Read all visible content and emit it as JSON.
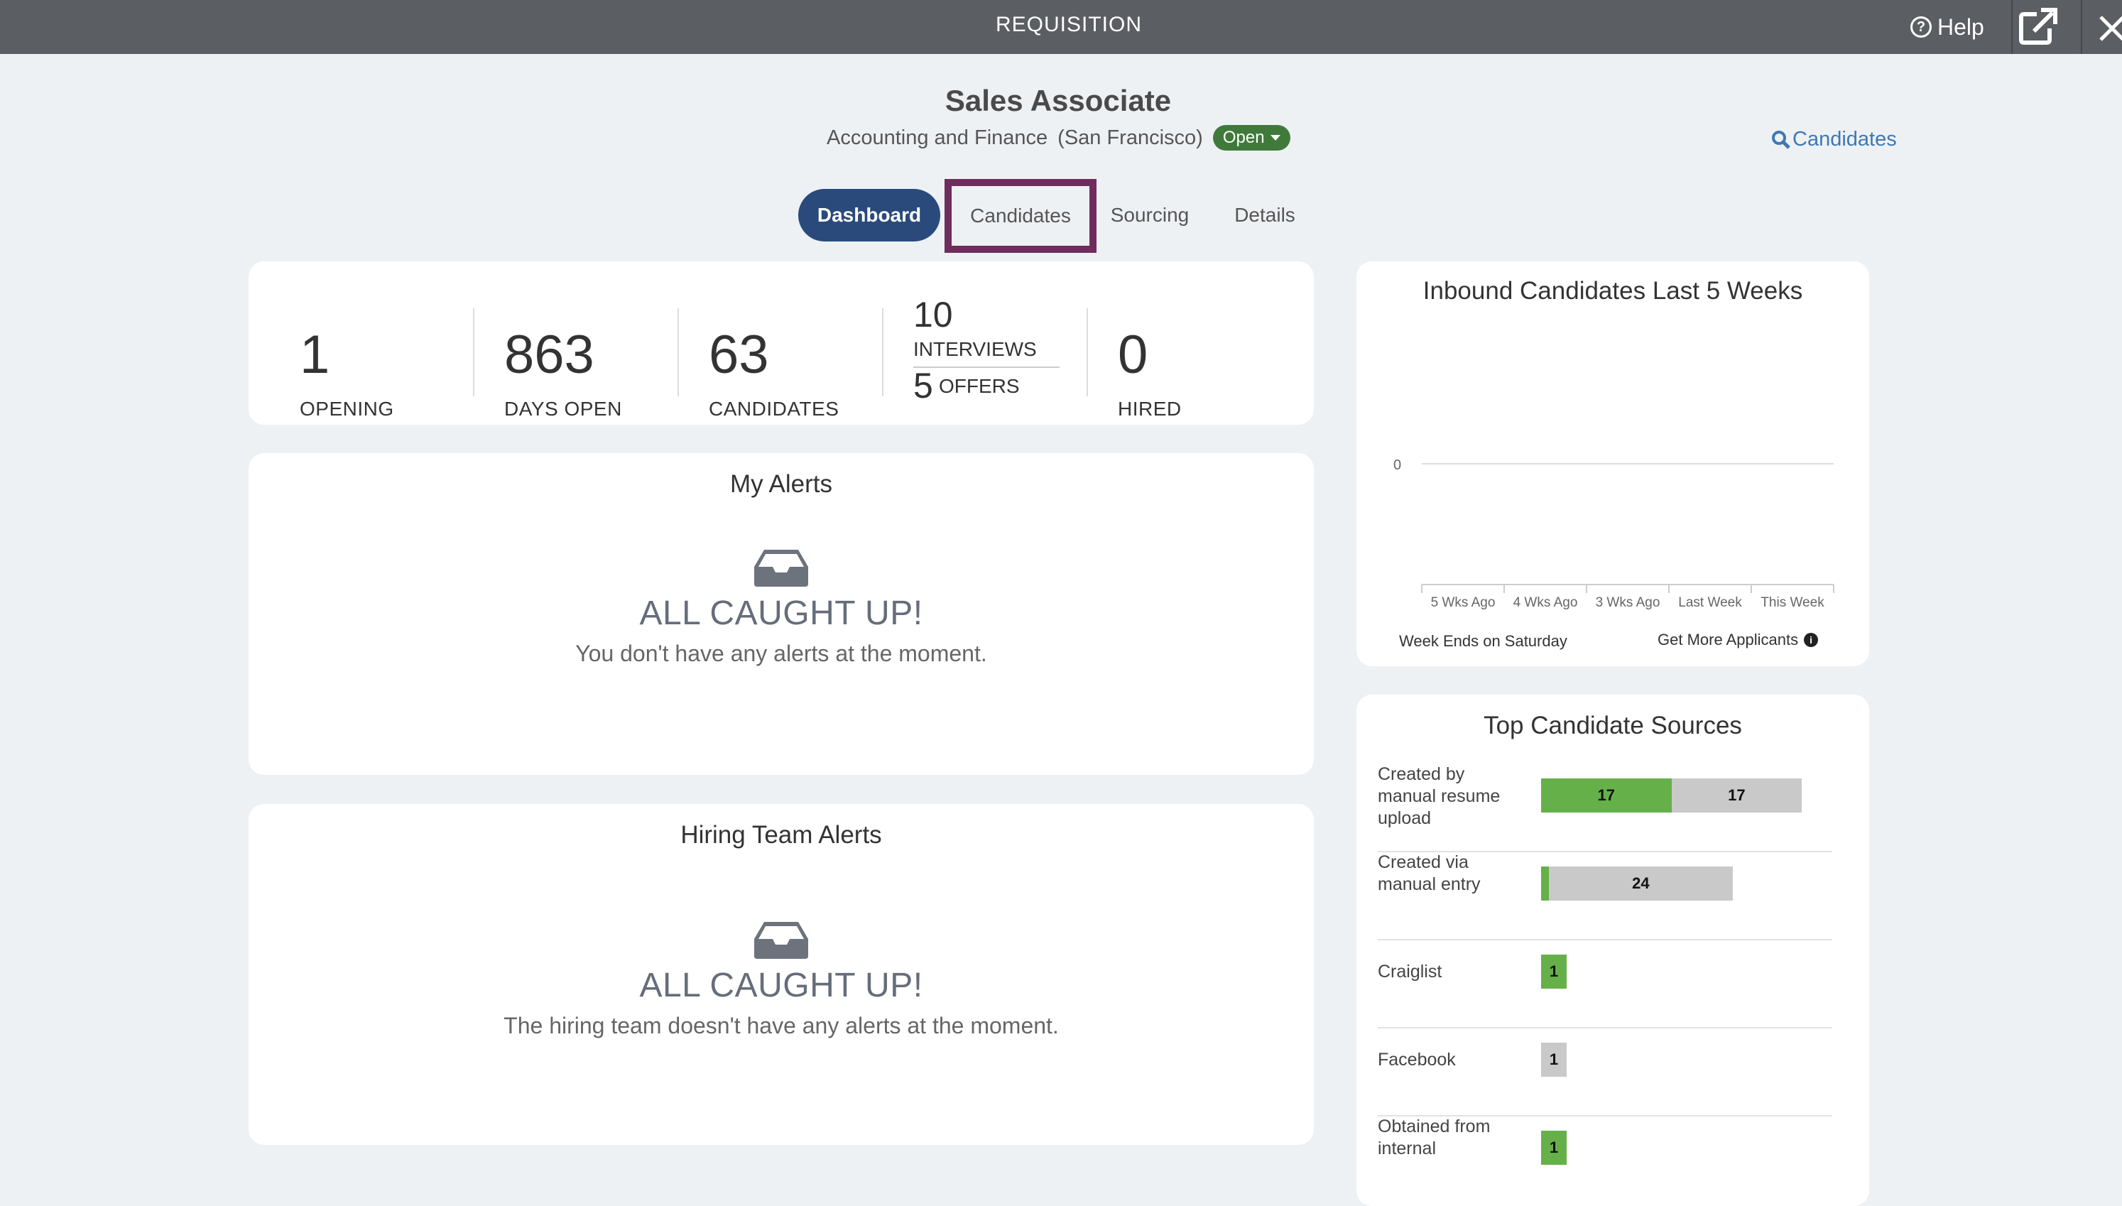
{
  "window": {
    "title": "REQUISITION",
    "help_label": "Help"
  },
  "requisition": {
    "title": "Sales Associate",
    "department": "Accounting and Finance",
    "location": "(San Francisco)",
    "status": "Open",
    "candidates_link": "Candidates"
  },
  "tabs": [
    {
      "label": "Dashboard",
      "active": true
    },
    {
      "label": "Candidates",
      "highlighted": true
    },
    {
      "label": "Sourcing"
    },
    {
      "label": "Details"
    }
  ],
  "stats": {
    "openings": {
      "value": "1",
      "label": "OPENING"
    },
    "days_open": {
      "value": "863",
      "label": "DAYS OPEN"
    },
    "candidates": {
      "value": "63",
      "label": "CANDIDATES"
    },
    "interviews": {
      "value": "10",
      "label": "INTERVIEWS"
    },
    "offers": {
      "value": "5",
      "label": "OFFERS"
    },
    "hired": {
      "value": "0",
      "label": "HIRED"
    }
  },
  "my_alerts": {
    "title": "My Alerts",
    "icon": "inbox-icon",
    "headline": "ALL CAUGHT UP!",
    "message": "You don't have any alerts at the moment."
  },
  "team_alerts": {
    "title": "Hiring Team Alerts",
    "icon": "inbox-icon",
    "headline": "ALL CAUGHT UP!",
    "message": "The hiring team doesn't have any alerts at the moment."
  },
  "inbound": {
    "title": "Inbound Candidates Last 5 Weeks",
    "footer_left": "Week Ends on Saturday",
    "footer_right": "Get More Applicants",
    "chart_data": {
      "type": "line",
      "title": "Inbound Candidates Last 5 Weeks",
      "categories": [
        "5 Wks Ago",
        "4 Wks Ago",
        "3 Wks Ago",
        "Last Week",
        "This Week"
      ],
      "yticks": [
        "0"
      ],
      "values": [
        0,
        0,
        0,
        0,
        0
      ]
    }
  },
  "sources": {
    "title": "Top Candidate Sources",
    "colors": {
      "green": "#66b04a",
      "gray": "#c9c9c9"
    },
    "rows": [
      {
        "label": "Created by manual resume upload",
        "green": 17,
        "gray": 17
      },
      {
        "label": "Created via manual entry",
        "green": 1,
        "gray": 24
      },
      {
        "label": "Craiglist",
        "green": 1,
        "gray": 0
      },
      {
        "label": "Facebook",
        "green": 0,
        "gray": 1
      },
      {
        "label": "Obtained from internal",
        "green": 1,
        "gray": 0
      }
    ]
  }
}
